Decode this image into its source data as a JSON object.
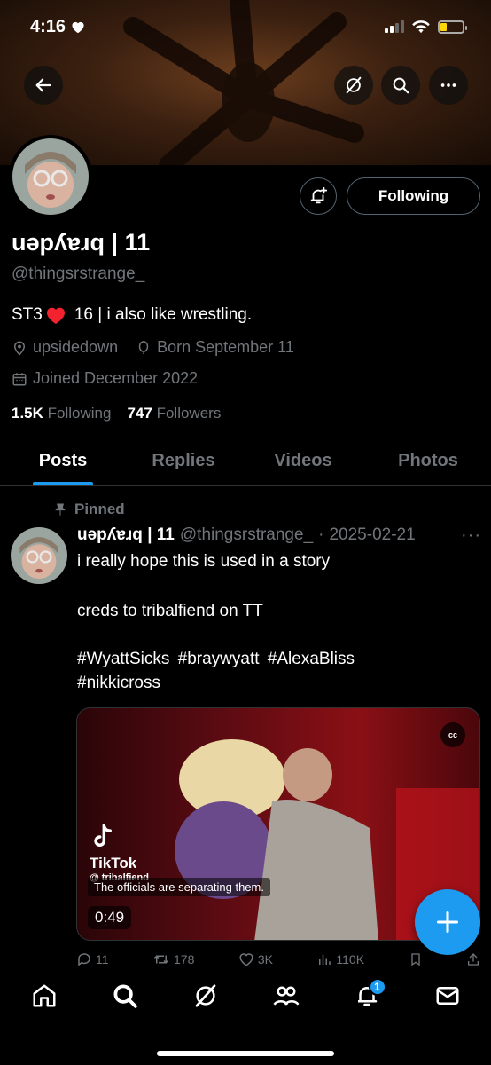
{
  "status_bar": {
    "time": "4:16"
  },
  "profile": {
    "display_name": "uǝpʎɐɹq | 11",
    "handle": "@thingsrstrange_",
    "bio_prefix": "ST3",
    "bio_suffix": "16 | i also like wrestling.",
    "location": "upsidedown",
    "birthday": "Born September 11",
    "joined": "Joined December 2022",
    "following_count": "1.5K",
    "following_label": "Following",
    "followers_count": "747",
    "followers_label": "Followers",
    "follow_button_label": "Following"
  },
  "tabs": [
    {
      "label": "Posts",
      "active": true
    },
    {
      "label": "Replies",
      "active": false
    },
    {
      "label": "Videos",
      "active": false
    },
    {
      "label": "Photos",
      "active": false
    }
  ],
  "post": {
    "pinned_label": "Pinned",
    "author_name": "uǝpʎɐɹq | 11",
    "author_handle": "@thingsrstrange_",
    "separator": "·",
    "date": "2025-02-21",
    "more": "···",
    "text_line1": "i really hope this is used in a story",
    "text_line2": "creds to tribalfiend on TT",
    "hashtags_line1": [
      "#WyattSicks",
      "#braywyatt",
      "#AlexaBliss"
    ],
    "hashtags_line2": [
      "#nikkicross"
    ],
    "media": {
      "cc_label": "cc",
      "watermark_brand": "TikTok",
      "watermark_user": "@ tribalfiend",
      "caption": "The officials are separating them.",
      "duration": "0:49"
    },
    "actions": {
      "replies": "11",
      "reposts": "178",
      "likes": "3K",
      "views": "110K"
    }
  },
  "bottom_nav": {
    "notifications_badge": "1"
  },
  "colors": {
    "accent": "#1d9bf0",
    "background": "#000000",
    "muted_text": "#71767b",
    "heart": "#f4212e",
    "battery": "#ffd60a"
  },
  "icons": [
    "back-arrow-icon",
    "grok-icon",
    "search-icon",
    "more-icon",
    "notify-bell-plus-icon",
    "location-pin-icon",
    "balloon-icon",
    "calendar-icon",
    "pin-icon",
    "reply-icon",
    "repost-icon",
    "like-icon",
    "views-icon",
    "bookmark-icon",
    "share-icon",
    "plus-icon",
    "home-icon",
    "communities-icon",
    "bell-icon",
    "mail-icon"
  ]
}
